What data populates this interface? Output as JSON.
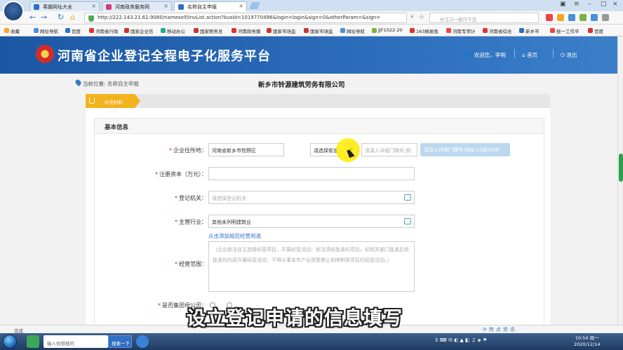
{
  "browser": {
    "tabs": [
      {
        "label": "毒霸网址大全",
        "icon_color": "#2f6fc4"
      },
      {
        "label": "河南政务服务网",
        "icon_color": "#d93a7a"
      },
      {
        "label": "名称自主申报",
        "icon_color": "#2f6fc4"
      }
    ],
    "url": "http://222.143.21.61:9080/nameself/invList.action?busId=1019770496&login=login&sign=0&otherParam=&sign=",
    "search_placeholder": "长江口一船只下沉",
    "bookmarks": [
      "收藏",
      "网址导航",
      "百度",
      "河南省行政",
      "国家企业信",
      "移动办公",
      "国家税务总",
      "河南政务服",
      "国家市场监",
      "国家市场监",
      "网址导航",
      "JJF1022-20",
      "163网易免",
      "河南专项计",
      "河南省综合",
      "新乡市",
      "统一工作平",
      "百度"
    ]
  },
  "header": {
    "title": "河南省企业登记全程电子化服务平台",
    "welcome": "欢迎您，李明",
    "home": "首页",
    "logout": "退出"
  },
  "location": {
    "label": "当前位置: 名称自主申报",
    "company": "新乡市铃源建筑劳务有限公司"
  },
  "step": {
    "label": "补充材料"
  },
  "form": {
    "section_title": "基本信息",
    "address": {
      "label": "企业住所地：",
      "value": "河南省新乡市牧野区",
      "street_select": "请选择街道",
      "detail_placeholder": "请录入详细门牌号,例",
      "tip": "请录入详细门牌号,例如:XX路XX号"
    },
    "capital": {
      "label": "注册资本（万元）：",
      "value": ""
    },
    "authority": {
      "label": "登记机关：",
      "placeholder": "请选择登记机关"
    },
    "industry": {
      "label": "主营行业：",
      "value": "其他未列明建筑业"
    },
    "scope_link": "点击添加规范经营用语",
    "scope": {
      "label": "经营范围：",
      "placeholder": "（企业依法自主选择经营项目，开展经营活动；依法须经批准的项目，经相关部门批准后依批准的内容开展经营活动；不得从事本市产业政策禁止和限制类项目的经营活动。）"
    },
    "group": {
      "label": "是否集团母公司："
    }
  },
  "status": {
    "text": "完成",
    "zoom": "热点资讯"
  },
  "caption": "设立登记申请的信息填写",
  "taskbar": {
    "search_placeholder": "输入你想搜的",
    "search_button": "搜索一下",
    "time": "10:54 周一",
    "date": "2020/12/14"
  },
  "colors": {
    "banner": "#1b57a3",
    "accent": "#f3b31e",
    "required": "#e02020",
    "link": "#2c6fc6"
  }
}
